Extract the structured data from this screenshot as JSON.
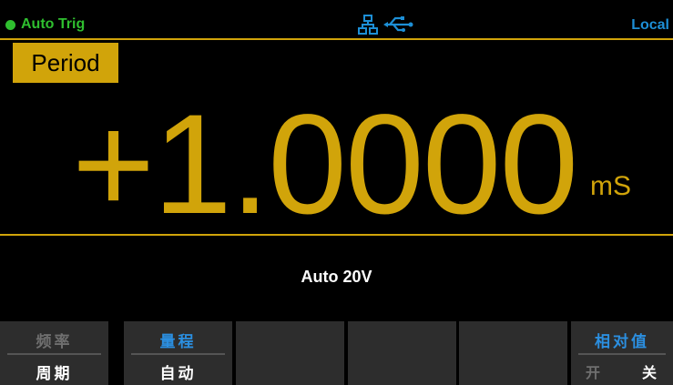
{
  "status": {
    "trigger_label": "Auto Trig",
    "remote_label": "Local",
    "icons": [
      "lan-icon",
      "usb-icon"
    ],
    "colors": {
      "trigger": "#2fbf2f",
      "remote": "#1d8fd6",
      "accent": "#d1a40a"
    }
  },
  "measurement": {
    "function_label": "Period",
    "value": "+1.0000",
    "unit": "mS",
    "range_text": "Auto 20V"
  },
  "softkeys": [
    {
      "top": "频率",
      "bottom": "周期"
    },
    {
      "top": "量程",
      "bottom": "自动"
    },
    {
      "top": "",
      "bottom": ""
    },
    {
      "top": "",
      "bottom": ""
    },
    {
      "top": "",
      "bottom": ""
    },
    {
      "top": "相对值",
      "options": [
        "开",
        "关"
      ]
    }
  ]
}
